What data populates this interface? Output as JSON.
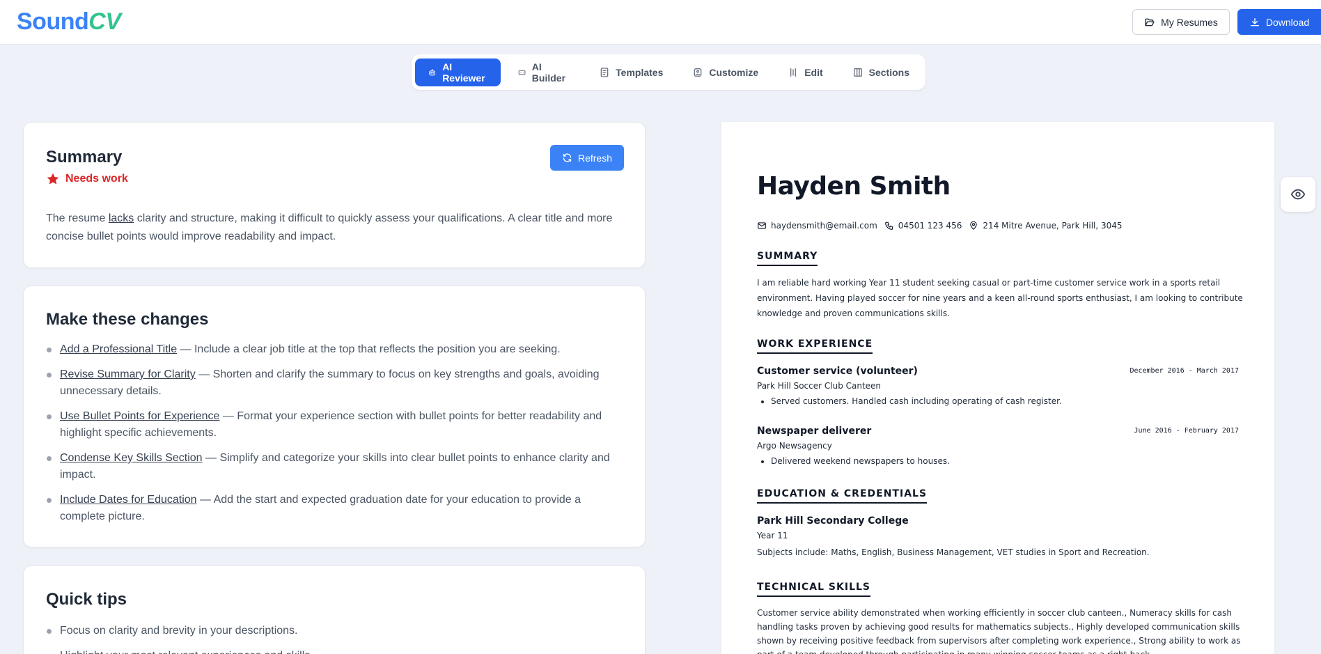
{
  "header": {
    "logo_part1": "Sound",
    "logo_part2": "CV",
    "my_resumes_label": "My Resumes",
    "download_label": "Download"
  },
  "tabs": [
    {
      "label": "AI Reviewer",
      "icon": "robot-icon",
      "active": true
    },
    {
      "label": "AI Builder",
      "icon": "bot-icon",
      "active": false
    },
    {
      "label": "Templates",
      "icon": "document-icon",
      "active": false
    },
    {
      "label": "Customize",
      "icon": "palette-icon",
      "active": false
    },
    {
      "label": "Edit",
      "icon": "edit-icon",
      "active": false
    },
    {
      "label": "Sections",
      "icon": "columns-icon",
      "active": false
    }
  ],
  "summary_card": {
    "title": "Summary",
    "status": "Needs work",
    "refresh_label": "Refresh",
    "text_before": "The resume ",
    "text_link": "lacks",
    "text_after": " clarity and structure, making it difficult to quickly assess your qualifications. A clear title and more concise bullet points would improve readability and impact."
  },
  "changes_card": {
    "title": "Make these changes",
    "items": [
      {
        "link": "Add a Professional Title",
        "text": " — Include a clear job title at the top that reflects the position you are seeking."
      },
      {
        "link": "Revise Summary for Clarity",
        "text": " — Shorten and clarify the summary to focus on key strengths and goals, avoiding unnecessary details."
      },
      {
        "link": "Use Bullet Points for Experience",
        "text": " — Format your experience section with bullet points for better readability and highlight specific achievements."
      },
      {
        "link": "Condense Key Skills Section",
        "text": " — Simplify and categorize your skills into clear bullet points to enhance clarity and impact."
      },
      {
        "link": "Include Dates for Education",
        "text": " — Add the start and expected graduation date for your education to provide a complete picture."
      }
    ]
  },
  "tips_card": {
    "title": "Quick tips",
    "items": [
      "Focus on clarity and brevity in your descriptions.",
      "Highlight your most relevant experiences and skills."
    ]
  },
  "resume": {
    "name": "Hayden Smith",
    "email": "haydensmith@email.com",
    "phone": "04501 123 456",
    "address": "214 Mitre Avenue, Park Hill, 3045",
    "summary_heading": "SUMMARY",
    "summary_text": "I am reliable hard working Year 11 student seeking casual or part-time customer service work in a sports retail environment. Having played soccer for nine years and a keen all-round sports enthusiast, I am looking to contribute knowledge and proven communications skills.",
    "work_heading": "WORK EXPERIENCE",
    "jobs": [
      {
        "title": "Customer service (volunteer)",
        "dates": "December 2016 - March 2017",
        "company": "Park Hill Soccer Club Canteen",
        "bullet": "Served customers. Handled cash including operating of cash register."
      },
      {
        "title": "Newspaper deliverer",
        "dates": "June 2016 - February 2017",
        "company": "Argo Newsagency",
        "bullet": "Delivered weekend newspapers to houses."
      }
    ],
    "education_heading": "EDUCATION & CREDENTIALS",
    "school": "Park Hill Secondary College",
    "year": "Year 11",
    "subjects": "Subjects include: Maths, English, Business Management, VET studies in Sport and Recreation.",
    "skills_heading": "TECHNICAL SKILLS",
    "skills_text": "Customer service ability demonstrated when working efficiently in soccer club canteen., Numeracy skills for cash handling tasks proven by achieving good results for mathematics subjects., Highly developed communication skills shown by receiving positive feedback from supervisors after completing work experience., Strong ability to work as part of a team developed through participating in many winning soccer teams as a right-back."
  },
  "colors": {
    "accent": "#2563eb",
    "status_bad": "#dc2626",
    "logo_green": "#34c38f"
  }
}
